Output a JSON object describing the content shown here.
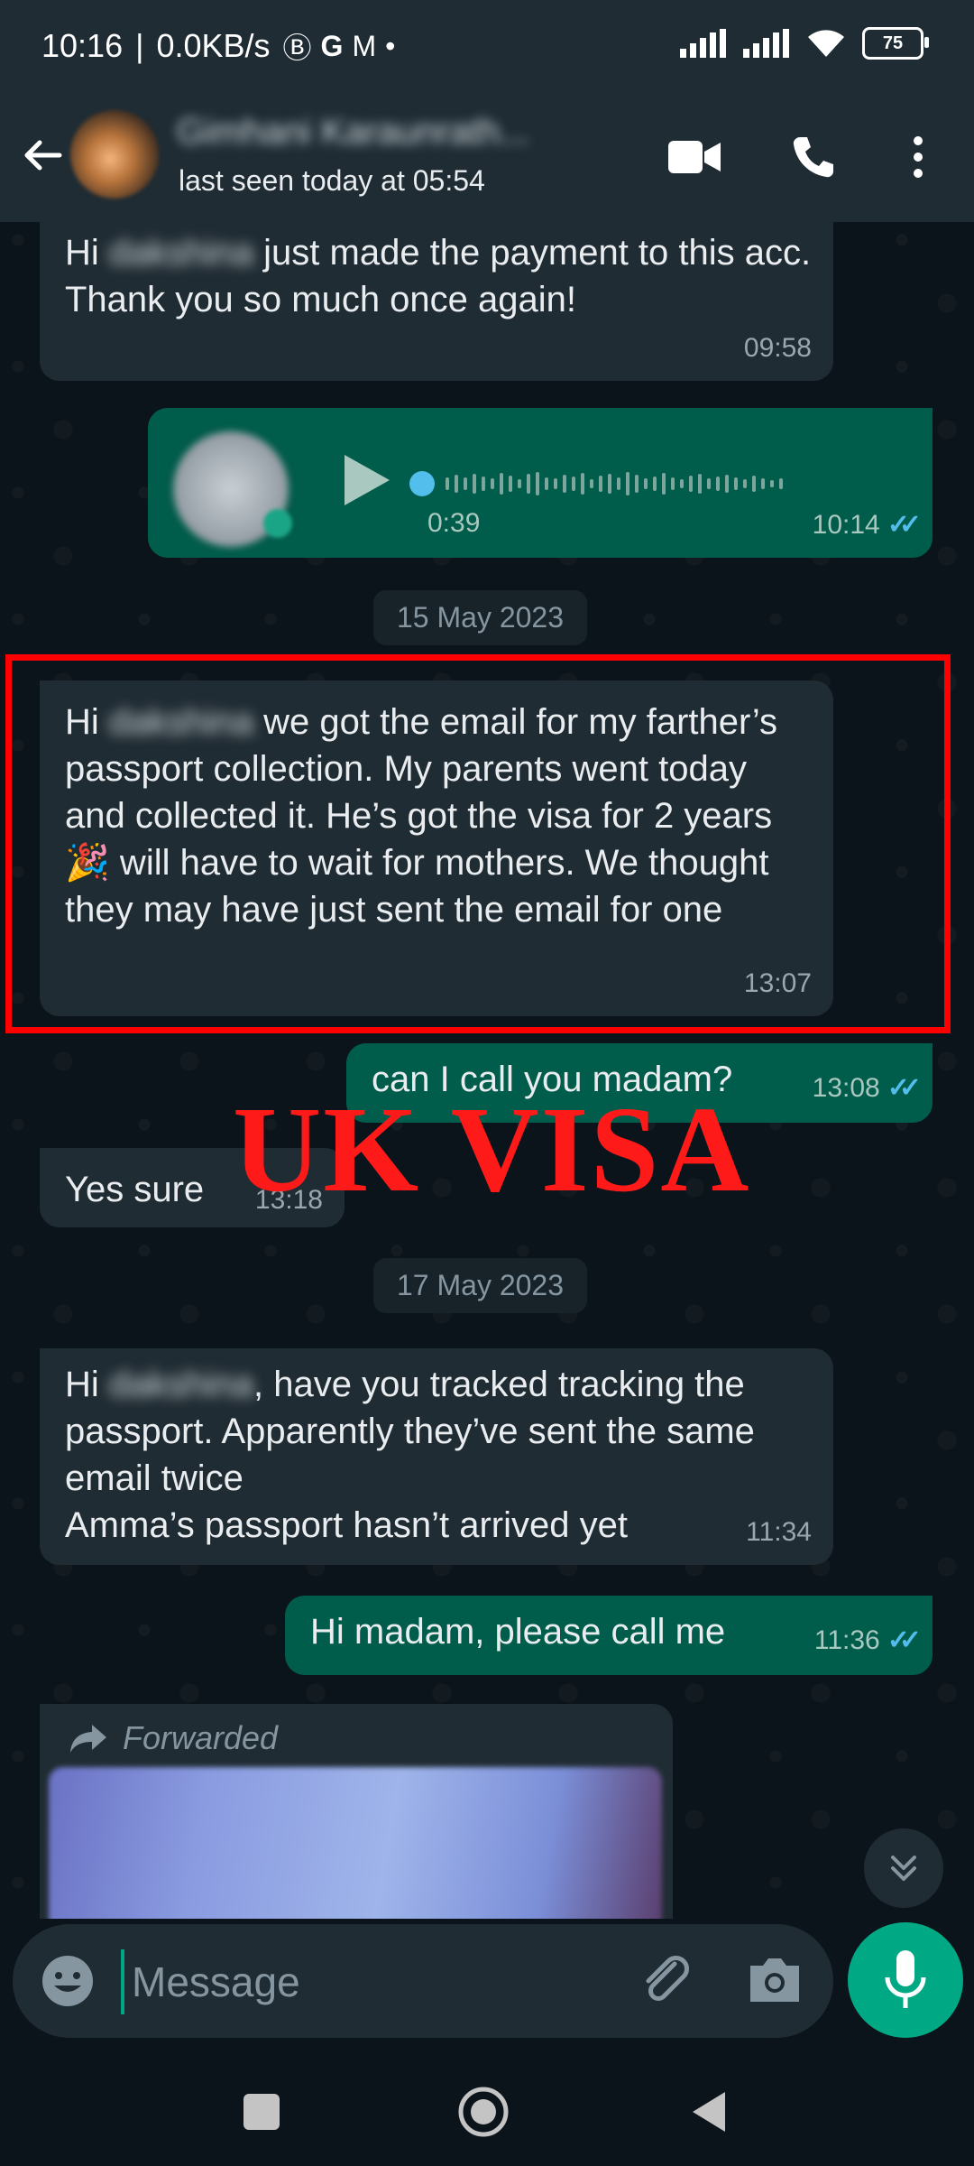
{
  "status_bar": {
    "time": "10:16",
    "network_speed": "0.0KB/s",
    "battery": "75"
  },
  "header": {
    "contact_name": "Gimhani Karaunrath...",
    "last_seen": "last seen today at 05:54"
  },
  "messages": [
    {
      "dir": "in",
      "greeting": "Hi",
      "blurred": "dakshina",
      "text": " just made the payment to this acc. Thank you so much once again!",
      "time": "09:58"
    },
    {
      "dir": "out",
      "type": "voice",
      "duration": "0:39",
      "time": "10:14"
    },
    {
      "type": "date",
      "label": "15 May 2023"
    },
    {
      "dir": "in",
      "greeting": "Hi",
      "blurred": "dakshina",
      "text_a": " we got the email for my farther’s passport collection. My parents went today and collected it. He’s got the visa for 2 years ",
      "emoji": "🎉",
      "text_b": " will have to wait for mothers. We thought they may have just sent the email for one",
      "time": "13:07"
    },
    {
      "dir": "out",
      "text": "can I call you madam?",
      "time": "13:08"
    },
    {
      "dir": "in",
      "text": "Yes sure",
      "time": "13:18"
    },
    {
      "type": "date",
      "label": "17 May 2023"
    },
    {
      "dir": "in",
      "greeting": "Hi",
      "blurred": "dakshina",
      "text_a": ", have you tracked tracking the passport. Apparently they’ve sent the same email twice",
      "text_b": "Amma’s passport hasn’t arrived yet",
      "time": "11:34"
    },
    {
      "dir": "out",
      "text": "Hi madam, please call me",
      "time": "11:36"
    },
    {
      "dir": "in",
      "type": "forwarded",
      "label": "Forwarded"
    }
  ],
  "overlay": {
    "title": "UK VISA",
    "color": "#ff1a1a"
  },
  "composer": {
    "placeholder": "Message"
  },
  "icons": [
    "back-arrow-icon",
    "video-call-icon",
    "phone-icon",
    "more-options-icon",
    "play-icon",
    "double-check-icon",
    "forward-arrow-icon",
    "scroll-down-icon",
    "emoji-icon",
    "attach-icon",
    "camera-icon",
    "mic-icon",
    "nav-recents-icon",
    "nav-home-icon",
    "nav-back-icon"
  ],
  "colors": {
    "incoming": "#202c33",
    "outgoing": "#005c4b",
    "accent": "#00a884",
    "read_ticks": "#53bdeb"
  }
}
